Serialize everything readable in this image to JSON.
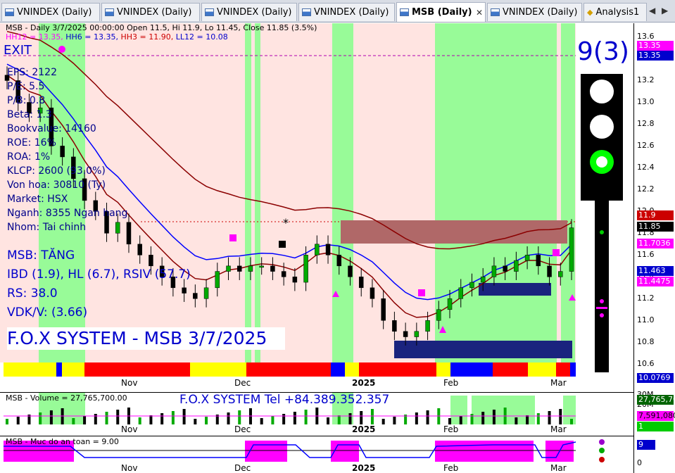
{
  "tabs": [
    {
      "label": "VNINDEX (Daily)",
      "active": false
    },
    {
      "label": "VNINDEX (Daily)",
      "active": false
    },
    {
      "label": "VNINDEX (Daily)",
      "active": false
    },
    {
      "label": "VNINDEX (Daily)",
      "active": false
    },
    {
      "label": "MSB (Daily)",
      "active": true
    },
    {
      "label": "VNINDEX (Daily)",
      "active": false
    },
    {
      "label": "Analysis1",
      "active": false
    }
  ],
  "tab_close": "✕",
  "nav": {
    "prev": "◀",
    "next": "▶"
  },
  "header": {
    "line1": "MSB - Daily 3/7/2025 00:00:00 Open 11.5, Hi 11.9, Lo 11.45, Close 11.85 (3.5%)",
    "hh12": "HH12 = 13.35,",
    "hh6": "HH6 = 13.35,",
    "hh3": "HH3 = 11.90,",
    "ll12": "LL12 = 10.08"
  },
  "exit_label": "EXIT",
  "fundamentals": [
    "EPS: 2122",
    "P/E: 5.5",
    "P/B: 0.8",
    "Beta: 1.3",
    "Bookvalue: 14160",
    "ROE: 16%",
    "ROA: 1%",
    "KLCP: 2600 (93.0%)",
    "Von hoa: 30810 (Ty)",
    "Market: HSX",
    "Nganh: 8355 Ngan hang",
    "Nhom: Tai chinh"
  ],
  "summary": [
    "MSB: TĂNG",
    "IBD (1.9), HL (6.7), RSIV (57.7)",
    "RS: 38.0",
    "VDK/V:  (3.66)"
  ],
  "system_title": "F.O.X SYSTEM - MSB 3/7/2025",
  "signal_count": "9(3)",
  "x_labels": [
    "Nov",
    "Dec",
    "2025",
    "Feb",
    "Mar"
  ],
  "price_ticks": [
    "13.6",
    "13.4",
    "13.2",
    "13.0",
    "12.8",
    "12.6",
    "12.4",
    "12.2",
    "12.0",
    "11.8",
    "11.6",
    "11.4",
    "11.2",
    "11.0",
    "10.8",
    "10.6"
  ],
  "price_tags": [
    {
      "text": "13.35",
      "color": "#ff00ff"
    },
    {
      "text": "13.35",
      "color": "#0000cd"
    },
    {
      "text": "11.9",
      "color": "#cc0000"
    },
    {
      "text": "11.85",
      "color": "#000000"
    },
    {
      "text": "11.7036",
      "color": "#ff00ff"
    },
    {
      "text": "11.463",
      "color": "#0000cd"
    },
    {
      "text": "11.4475",
      "color": "#ff00ff"
    },
    {
      "text": "10.0769",
      "color": "#0000cd"
    }
  ],
  "volume": {
    "label": "MSB - Volume = 27,765,700.00",
    "contact": "F.O.X SYSTEM Tel +84.389.352.357",
    "ticks": [
      "30M",
      "20M"
    ],
    "tag_last": "27,765,70",
    "tag_ma": "7,591,080",
    "tag_small": "1"
  },
  "safety": {
    "label": "MSB - Muc do an toan = 9.00",
    "tag": "9",
    "tick_zero": "0"
  },
  "chart_data": {
    "type": "candlestick",
    "ticker": "MSB",
    "date": "3/7/2025",
    "last": {
      "open": 11.5,
      "high": 11.9,
      "low": 11.45,
      "close": 11.85,
      "change_pct": 3.5
    },
    "ylim": [
      10.55,
      13.7
    ],
    "reference_levels": {
      "HH12": 13.35,
      "HH6": 13.35,
      "HH3": 11.9,
      "LL12": 10.08
    },
    "close_series": [
      13.2,
      13.0,
      12.9,
      12.95,
      12.6,
      12.5,
      12.3,
      12.1,
      12.0,
      11.8,
      11.9,
      11.7,
      11.6,
      11.5,
      11.4,
      11.3,
      11.25,
      11.2,
      11.3,
      11.45,
      11.5,
      11.45,
      11.5,
      11.5,
      11.45,
      11.4,
      11.35,
      11.6,
      11.7,
      11.6,
      11.5,
      11.4,
      11.3,
      11.2,
      11.0,
      10.9,
      10.85,
      10.9,
      11.0,
      11.1,
      11.2,
      11.3,
      11.35,
      11.4,
      11.5,
      11.45,
      11.55,
      11.6,
      11.5,
      11.4,
      11.45,
      11.85
    ]
  }
}
